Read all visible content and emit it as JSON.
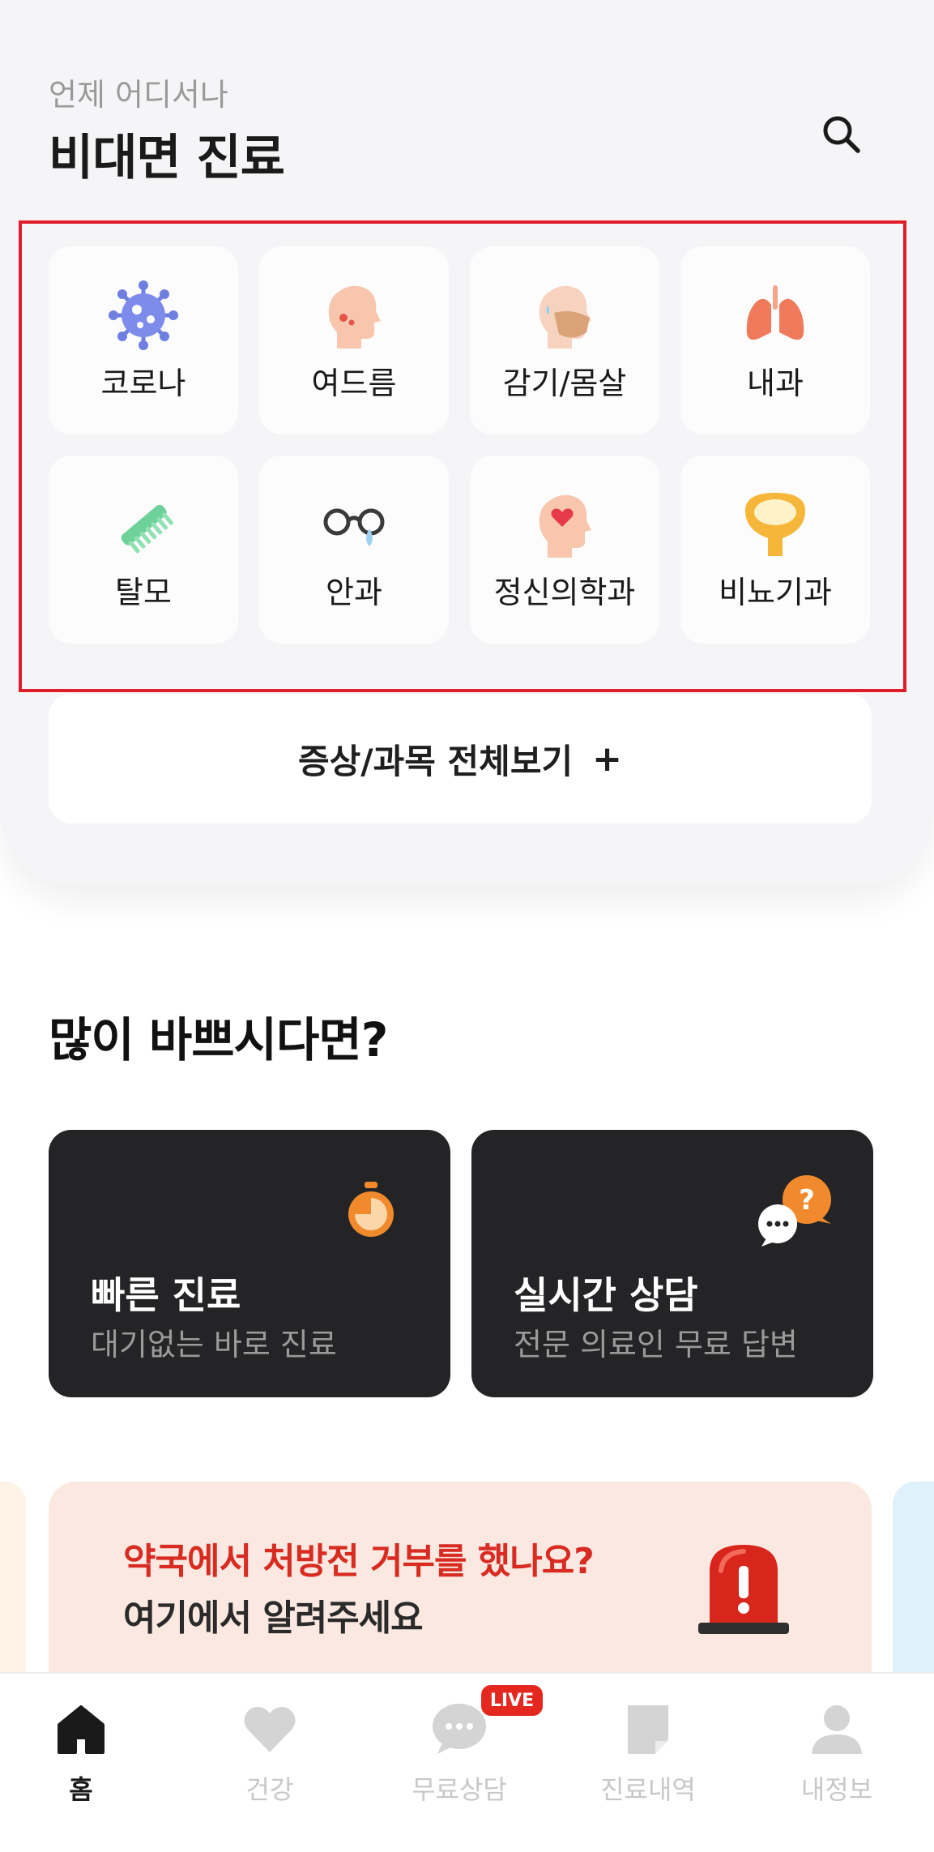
{
  "header": {
    "subtitle": "언제 어디서나",
    "title": "비대면 진료",
    "search_icon": "search-icon"
  },
  "categories": [
    {
      "label": "코로나",
      "icon": "virus-icon"
    },
    {
      "label": "여드름",
      "icon": "acne-face-icon"
    },
    {
      "label": "감기/몸살",
      "icon": "mask-face-icon"
    },
    {
      "label": "내과",
      "icon": "lungs-icon"
    },
    {
      "label": "탈모",
      "icon": "comb-icon"
    },
    {
      "label": "안과",
      "icon": "glasses-icon"
    },
    {
      "label": "정신의학과",
      "icon": "heart-head-icon"
    },
    {
      "label": "비뇨기과",
      "icon": "bladder-icon"
    }
  ],
  "view_all": {
    "label": "증상/과목 전체보기",
    "plus": "+"
  },
  "busy_section": {
    "title": "많이 바쁘시다면?",
    "cards": [
      {
        "title": "빠른 진료",
        "subtitle": "대기없는 바로 진료",
        "icon": "stopwatch-icon"
      },
      {
        "title": "실시간 상담",
        "subtitle": "전문 의료인 무료 답변",
        "icon": "chat-question-icon"
      }
    ]
  },
  "banner": {
    "line1": "약국에서 처방전 거부를 했나요?",
    "line2": "여기에서 알려주세요",
    "icon": "siren-icon"
  },
  "tabbar": {
    "items": [
      {
        "label": "홈",
        "icon": "home-icon",
        "active": true
      },
      {
        "label": "건강",
        "icon": "heart-icon",
        "active": false
      },
      {
        "label": "무료상담",
        "icon": "chat-icon",
        "active": false
      },
      {
        "label": "진료내역",
        "icon": "document-icon",
        "active": false
      },
      {
        "label": "내정보",
        "icon": "person-icon",
        "active": false
      }
    ],
    "live_badge": "LIVE"
  },
  "colors": {
    "accent_red": "#d82b22",
    "highlight_red": "#e11d2a",
    "dark_card": "#242426",
    "orange": "#f08a2c"
  }
}
